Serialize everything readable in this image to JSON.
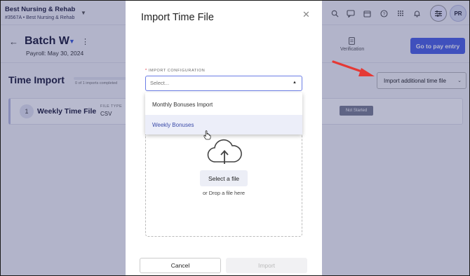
{
  "header": {
    "org_name": "Best Nursing & Rehab",
    "org_sub": "#3567A • Best Nursing & Rehab",
    "avatar_initials": "PR",
    "icons": [
      "search-icon",
      "chat-icon",
      "calendar-icon",
      "help-icon",
      "apps-grid-icon",
      "bell-icon",
      "sliders-icon"
    ]
  },
  "batch": {
    "title": "Batch W",
    "payroll": "Payroll: May 30, 2024",
    "verification_label": "Verification",
    "go_to_pay_entry": "Go to pay entry"
  },
  "time_import": {
    "title": "Time Import",
    "progress_label": "0 of 1 imports completed",
    "progress_fraction": 0,
    "import_additional": "Import additional time file",
    "card": {
      "step": "1",
      "name": "Weekly Time File",
      "file_type_label": "FILE TYPE",
      "file_type": "CSV",
      "status": "Not Started"
    }
  },
  "modal": {
    "title": "Import Time File",
    "config_label": "IMPORT CONFIGURATION",
    "required_mark": "*",
    "config_placeholder": "Select...",
    "options": [
      "Monthly Bonuses Import",
      "Weekly Bonuses"
    ],
    "highlighted_option": 1,
    "select_file": "Select a file",
    "drop_text": "or Drop a file here",
    "cancel": "Cancel",
    "import": "Import"
  },
  "colors": {
    "accent": "#4b61e6",
    "annotation_arrow": "#e53935",
    "overlay": "#282d69"
  }
}
